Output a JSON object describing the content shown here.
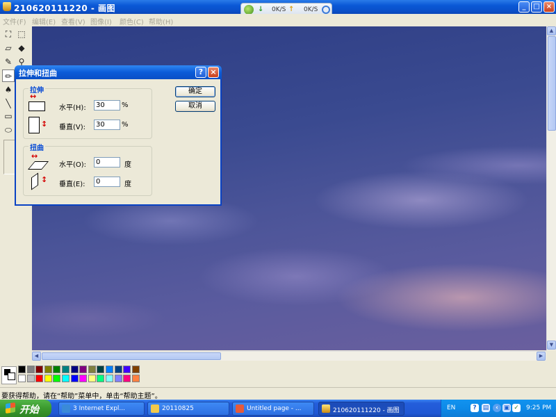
{
  "window": {
    "title": "210620111220 - 画图",
    "minimize": "_",
    "maximize": "□",
    "close": "×"
  },
  "download_widget": {
    "down_speed": "0K/S",
    "up_speed": "0K/S"
  },
  "menu": [
    "文件(F)",
    "编辑(E)",
    "查看(V)",
    "图像(I)",
    "颜色(C)",
    "帮助(H)"
  ],
  "dialog": {
    "title": "拉伸和扭曲",
    "help": "?",
    "close": "×",
    "stretch": {
      "label": "拉伸",
      "horizontal_label": "水平(H):",
      "horizontal_value": "30",
      "horizontal_unit": "%",
      "vertical_label": "垂直(V):",
      "vertical_value": "30",
      "vertical_unit": "%"
    },
    "skew": {
      "label": "扭曲",
      "horizontal_label": "水平(O):",
      "horizontal_value": "0",
      "horizontal_unit": "度",
      "vertical_label": "垂直(E):",
      "vertical_value": "0",
      "vertical_unit": "度"
    },
    "ok": "确定",
    "cancel": "取消"
  },
  "palette": {
    "colors_top": [
      "#000000",
      "#808080",
      "#800000",
      "#808000",
      "#008000",
      "#008080",
      "#000080",
      "#800080",
      "#808040",
      "#004040",
      "#0080ff",
      "#004080",
      "#4000ff",
      "#804000"
    ],
    "colors_bottom": [
      "#ffffff",
      "#c0c0c0",
      "#ff0000",
      "#ffff00",
      "#00ff00",
      "#00ffff",
      "#0000ff",
      "#ff00ff",
      "#ffff80",
      "#00ff80",
      "#80ffff",
      "#8080ff",
      "#ff0080",
      "#ff8040"
    ]
  },
  "status": {
    "text": "要获得帮助，请在“帮助”菜单中，单击“帮助主题”。"
  },
  "taskbar": {
    "start": "开始",
    "tasks": [
      {
        "label": "3 Internet Expl...",
        "active": false
      },
      {
        "label": "20110825",
        "active": false
      },
      {
        "label": "Untitled page - ...",
        "active": false
      },
      {
        "label": "210620111220 - 画图",
        "active": true
      }
    ],
    "lang": "EN",
    "clock": "9:25 PM"
  }
}
